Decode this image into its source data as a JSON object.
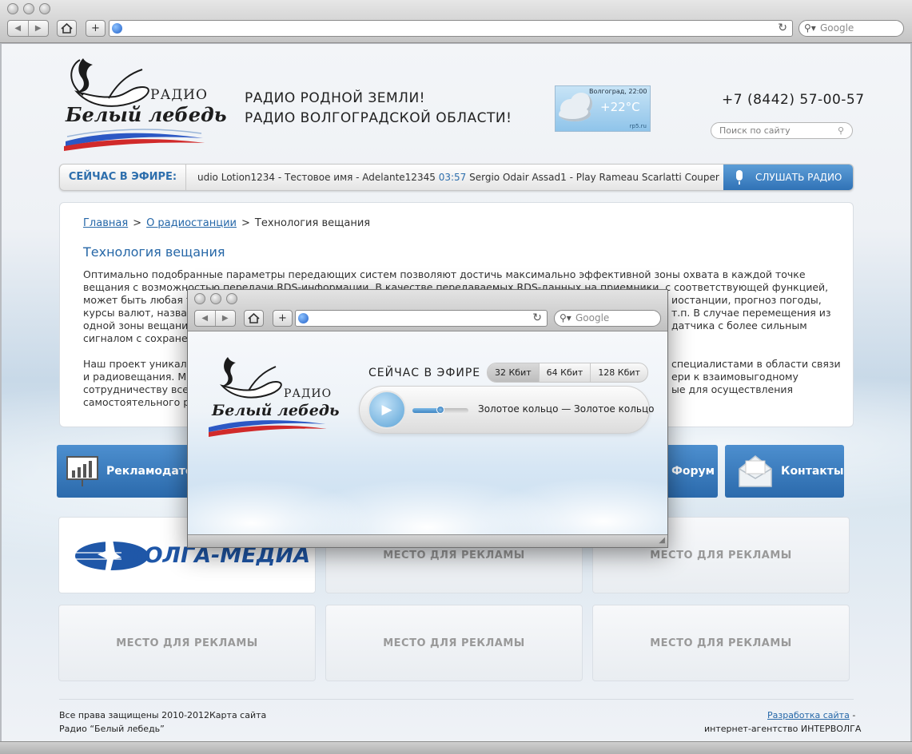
{
  "browser": {
    "search_placeholder": "Google"
  },
  "header": {
    "logo_radio": "РАДИО",
    "logo_name": "Белый лебедь",
    "slogan_line1": "РАДИО РОДНОЙ ЗЕМЛИ!",
    "slogan_line2": "РАДИО ВОЛГОГРАДСКОЙ ОБЛАСТИ!",
    "phone": "+7 (8442) 57-00-57",
    "site_search_placeholder": "Поиск по сайту"
  },
  "weather": {
    "city_time": "Волгоград, 22:00",
    "temperature": "+22°C",
    "source": "rp5.ru"
  },
  "on_air": {
    "label": "СЕЙЧАС В ЭФИРЕ:",
    "ticker_part1": "udio Lotion1234 - Тестовое имя - Adelante12345",
    "ticker_time": "03:57",
    "ticker_part2": "Sergio Odair Assad1 - Play Rameau Scarlatti Couper",
    "listen_button": "СЛУШАТЬ РАДИО"
  },
  "breadcrumb": {
    "home": "Главная",
    "separator": ">",
    "about": "О радиостанции",
    "current": "Технология вещания"
  },
  "article": {
    "title": "Технология вещания",
    "p1_line1": "Оптимально подобранные параметры передающих систем позволяют достичь максимально эффективной зоны охвата в каждой точке",
    "p1_line2": "вещания с возможностью передачи RDS-информации. В качестве передаваемых RDS-данных на приемники, с соответствующей функцией,",
    "p1_line3": "может быть любая т",
    "p1_line3_right": "иостанции, прогноз погоды,",
    "p1_line4": "курсы валют, назван",
    "p1_line4_right": "т.п. В случае перемещения из",
    "p1_line5": "одной зоны вещани",
    "p1_line5_right": "датчика с более сильным",
    "p1_line6": "сигналом с сохранен",
    "p2_line1": "Наш проект уникале",
    "p2_line1_right": "специалистами в области связи",
    "p2_line2": "и радиовещания. Мы",
    "p2_line2_right": "ери к взаимовыгодному",
    "p2_line3": "сотрудничеству всем",
    "p2_line3_right": "ые для осуществления",
    "p2_line4": "самостоятельного ра"
  },
  "tiles": {
    "advertisers": "Рекламодател",
    "forum": "Форум",
    "contacts": "Контакты"
  },
  "ads": {
    "partner_logo": "ВОЛГА-МЕДИА",
    "placeholder": "МЕСТО ДЛЯ РЕКЛАМЫ"
  },
  "footer": {
    "copyright": "Все права защищены 2010-2012",
    "sitemap": "Карта сайта",
    "station": "Радио “Белый лебедь”",
    "dev_link": "Разработка сайта",
    "dev_dash": "-",
    "agency": "интернет-агентство ИНТЕРВОЛГА"
  },
  "player": {
    "search_placeholder": "Google",
    "logo_radio": "РАДИО",
    "logo_name": "Белый лебедь",
    "on_air": "СЕЙЧАС В ЭФИРЕ",
    "bitrates": [
      "32 Кбит",
      "64 Кбит",
      "128 Кбит"
    ],
    "selected_bitrate": "32 Кбит",
    "track": "Золотое кольцо — Золотое кольцо",
    "volume_level": 0.5
  },
  "colors": {
    "accent": "#2e6fad",
    "tile_blue": "#3a7cc0",
    "flag_blue": "#2c58c4",
    "flag_red": "#d12a2a"
  }
}
